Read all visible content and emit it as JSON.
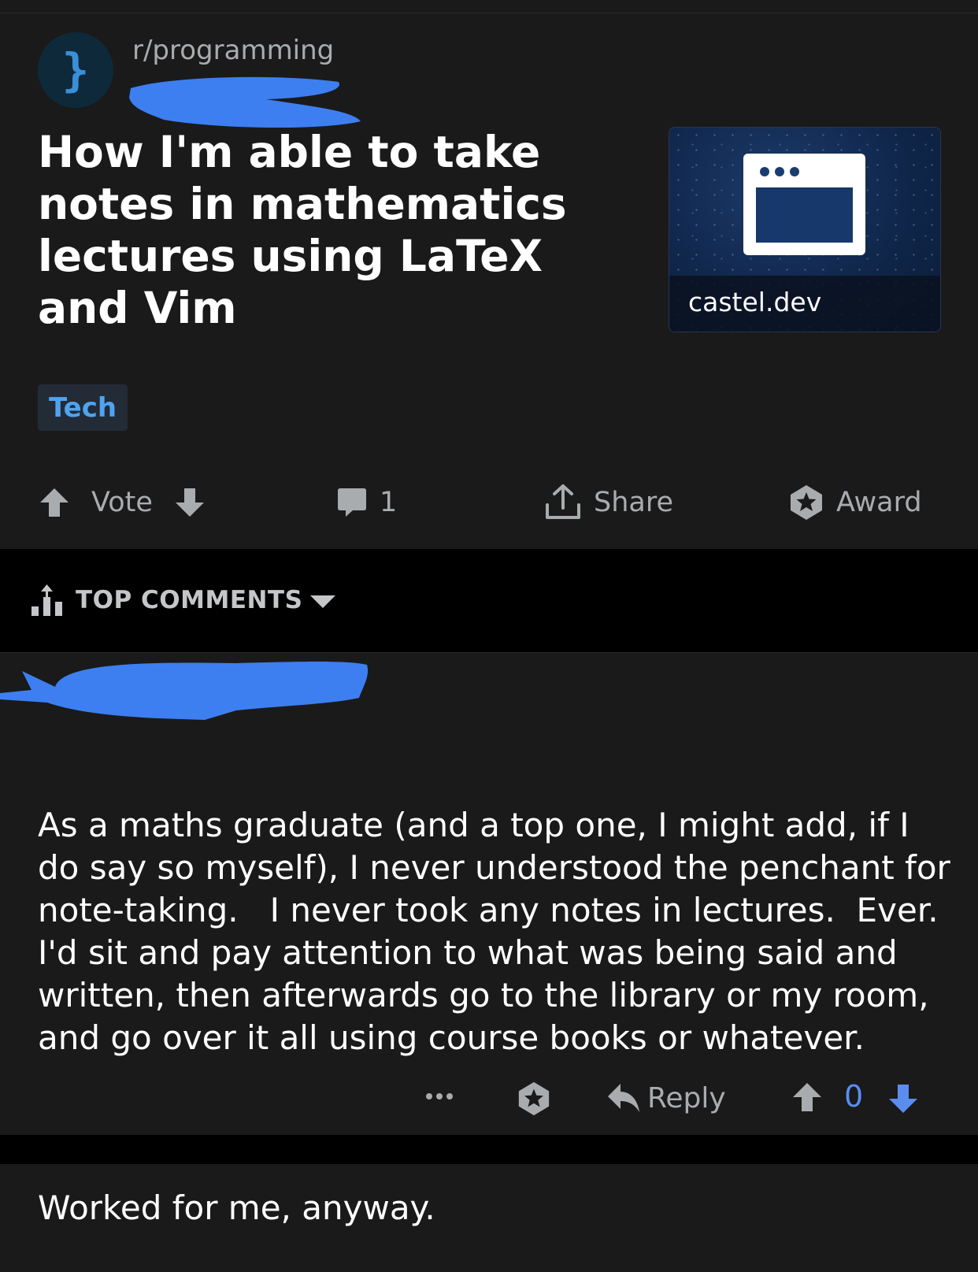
{
  "post": {
    "subreddit": "r/programming",
    "title": "How I'm able to take notes in mathematics lectures using LaTeX and Vim",
    "link_domain": "castel.dev",
    "flair": "Tech",
    "vote_label": "Vote",
    "comment_count": "1",
    "share_label": "Share",
    "award_label": "Award"
  },
  "sort": {
    "label": "TOP COMMENTS"
  },
  "comment": {
    "paragraphs": [
      "As a maths graduate (and a top one, I might add, if I do say so myself), I never understood the penchant for note-taking.   I never took any notes in lectures.  Ever.  I'd sit and pay attention to what was being said and written, then afterwards go to the library or my room, and go over it all using course books or whatever.",
      "Worked for me, anyway."
    ],
    "reply_label": "Reply",
    "score": "0"
  },
  "colors": {
    "background": "#1a1a1b",
    "redaction": "#3d7ff0",
    "flair_text": "#4fa3f0",
    "upvote_blue": "#5b8def"
  },
  "icons": [
    "subreddit-brace-icon",
    "browser-window-icon",
    "upvote-icon",
    "downvote-icon",
    "comment-icon",
    "share-icon",
    "award-icon",
    "sort-bars-icon",
    "caret-down-icon",
    "more-icon",
    "reply-icon"
  ]
}
